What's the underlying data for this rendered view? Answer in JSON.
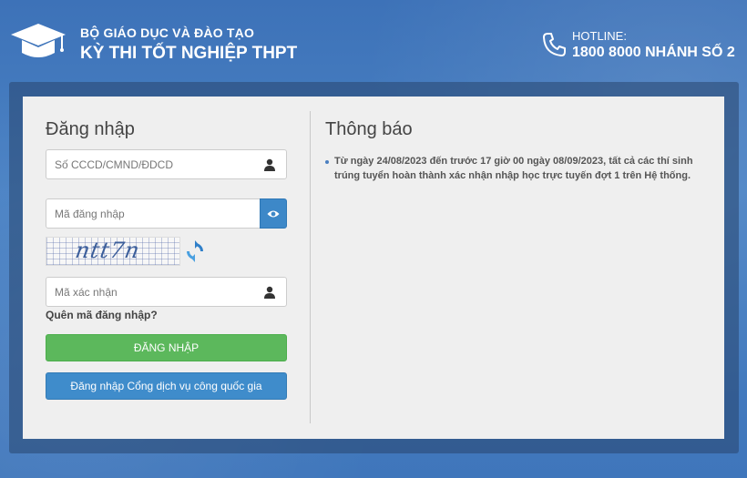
{
  "header": {
    "org_name": "BỘ GIÁO DỤC VÀ ĐÀO TẠO",
    "exam_name": "KỲ THI TỐT NGHIỆP THPT",
    "hotline_label": "HOTLINE:",
    "hotline_number": "1800 8000 NHÁNH SỐ 2"
  },
  "login": {
    "title": "Đăng nhập",
    "id_placeholder": "Số CCCD/CMND/ĐDCD",
    "password_placeholder": "Mã đăng nhập",
    "captcha_text": "ntt7n",
    "captcha_input_placeholder": "Mã xác nhận",
    "forgot_link": "Quên mã đăng nhập?",
    "login_button": "ĐĂNG NHẬP",
    "national_button": "Đăng nhập Cổng dịch vụ công quốc gia"
  },
  "notice": {
    "title": "Thông báo",
    "items": [
      "Từ ngày 24/08/2023 đến trước 17 giờ 00 ngày 08/09/2023, tất cả các thí sinh trúng tuyển hoàn thành xác nhận nhập học trực tuyến đợt 1 trên Hệ thống."
    ]
  },
  "colors": {
    "background": "#4177bb",
    "login_button": "#5cb85c",
    "national_button": "#3f8ccb",
    "eye_button": "#3d88c8"
  },
  "icons": [
    "graduation-cap-icon",
    "phone-icon",
    "user-icon",
    "eye-icon",
    "refresh-icon"
  ]
}
